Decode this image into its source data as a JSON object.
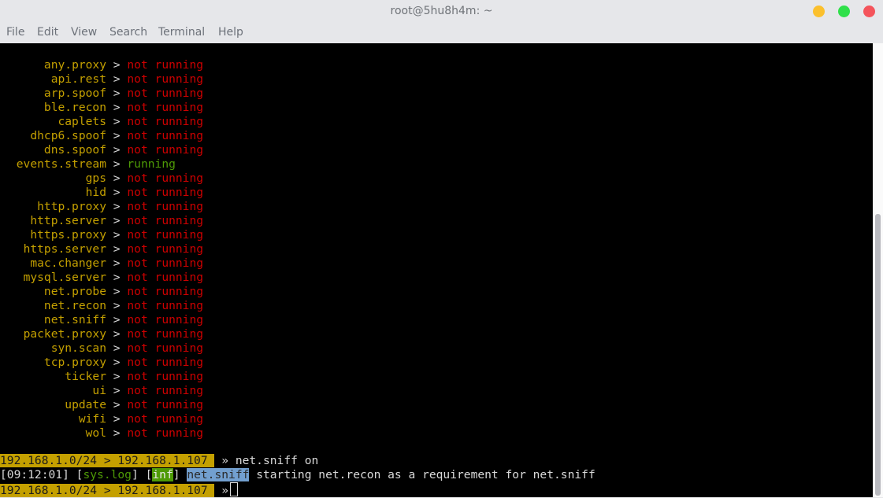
{
  "window": {
    "title": "root@5hu8h4m: ~"
  },
  "window_controls": {
    "minimize_color": "#fbc02d",
    "maximize_color": "#2fe04a",
    "close_color": "#f4545b"
  },
  "menubar": {
    "items": [
      "File",
      "Edit",
      "View",
      "Search",
      "Terminal",
      "Help"
    ]
  },
  "terminal": {
    "separator": ">",
    "modules": [
      {
        "name": "any.proxy",
        "status": "not running"
      },
      {
        "name": "api.rest",
        "status": "not running"
      },
      {
        "name": "arp.spoof",
        "status": "not running"
      },
      {
        "name": "ble.recon",
        "status": "not running"
      },
      {
        "name": "caplets",
        "status": "not running"
      },
      {
        "name": "dhcp6.spoof",
        "status": "not running"
      },
      {
        "name": "dns.spoof",
        "status": "not running"
      },
      {
        "name": "events.stream",
        "status": "running"
      },
      {
        "name": "gps",
        "status": "not running"
      },
      {
        "name": "hid",
        "status": "not running"
      },
      {
        "name": "http.proxy",
        "status": "not running"
      },
      {
        "name": "http.server",
        "status": "not running"
      },
      {
        "name": "https.proxy",
        "status": "not running"
      },
      {
        "name": "https.server",
        "status": "not running"
      },
      {
        "name": "mac.changer",
        "status": "not running"
      },
      {
        "name": "mysql.server",
        "status": "not running"
      },
      {
        "name": "net.probe",
        "status": "not running"
      },
      {
        "name": "net.recon",
        "status": "not running"
      },
      {
        "name": "net.sniff",
        "status": "not running"
      },
      {
        "name": "packet.proxy",
        "status": "not running"
      },
      {
        "name": "syn.scan",
        "status": "not running"
      },
      {
        "name": "tcp.proxy",
        "status": "not running"
      },
      {
        "name": "ticker",
        "status": "not running"
      },
      {
        "name": "ui",
        "status": "not running"
      },
      {
        "name": "update",
        "status": "not running"
      },
      {
        "name": "wifi",
        "status": "not running"
      },
      {
        "name": "wol",
        "status": "not running"
      }
    ],
    "prompt": {
      "subnet": "192.168.1.0/24",
      "arrow": ">",
      "host": "192.168.1.107",
      "chevron": "»"
    },
    "command1": "net.sniff on",
    "log": {
      "time": "[09:12:01]",
      "tag_open": "[",
      "tag": "sys.log",
      "tag_close": "]",
      "level_open": "[",
      "level": "inf",
      "level_close": "]",
      "module": "net.sniff",
      "message": "starting net.recon as a requirement for net.sniff"
    },
    "command2": ""
  },
  "colors": {
    "module_name": "#c4a000",
    "not_running": "#cc0000",
    "running": "#4e9a06",
    "prompt_bg": "#c4a000",
    "highlight_bg": "#729fcf"
  }
}
